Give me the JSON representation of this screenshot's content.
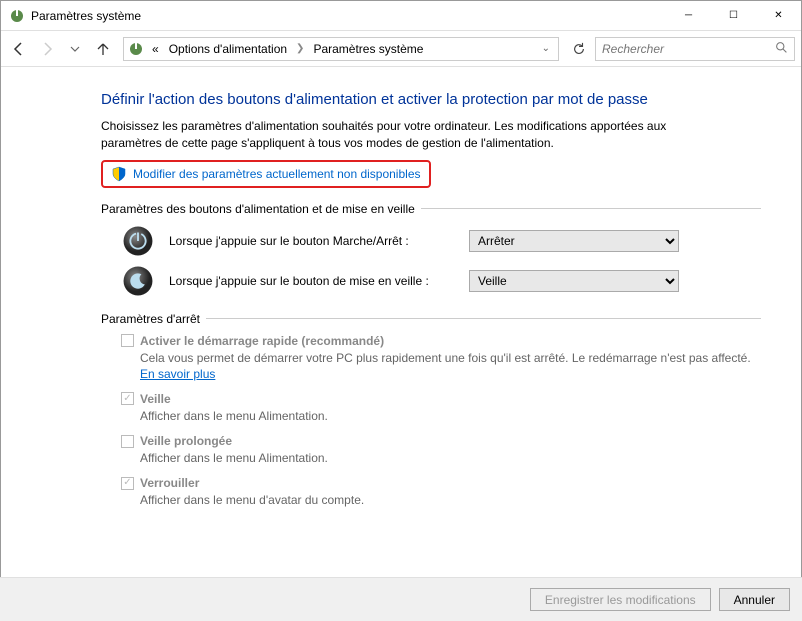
{
  "window": {
    "title": "Paramètres système"
  },
  "breadcrumb": {
    "prefix": "«",
    "items": [
      "Options d'alimentation",
      "Paramètres système"
    ]
  },
  "search": {
    "placeholder": "Rechercher"
  },
  "page": {
    "heading": "Définir l'action des boutons d'alimentation et activer la protection par mot de passe",
    "description": "Choisissez les paramètres d'alimentation souhaités pour votre ordinateur. Les modifications apportées aux paramètres de cette page s'appliquent à tous vos modes de gestion de l'alimentation.",
    "admin_link": "Modifier des paramètres actuellement non disponibles"
  },
  "buttons_section": {
    "legend": "Paramètres des boutons d'alimentation et de mise en veille",
    "power": {
      "label": "Lorsque j'appuie sur le bouton Marche/Arrêt :",
      "value": "Arrêter"
    },
    "sleep": {
      "label": "Lorsque j'appuie sur le bouton de mise en veille :",
      "value": "Veille"
    }
  },
  "shutdown_section": {
    "legend": "Paramètres d'arrêt",
    "fastboot": {
      "checked": false,
      "label": "Activer le démarrage rapide (recommandé)",
      "desc": "Cela vous permet de démarrer votre PC plus rapidement une fois qu'il est arrêté. Le redémarrage n'est pas affecté. ",
      "link": "En savoir plus"
    },
    "sleep": {
      "checked": true,
      "label": "Veille",
      "desc": "Afficher dans le menu Alimentation."
    },
    "hibernate": {
      "checked": false,
      "label": "Veille prolongée",
      "desc": "Afficher dans le menu Alimentation."
    },
    "lock": {
      "checked": true,
      "label": "Verrouiller",
      "desc": "Afficher dans le menu d'avatar du compte."
    }
  },
  "footer": {
    "save": "Enregistrer les modifications",
    "cancel": "Annuler"
  }
}
